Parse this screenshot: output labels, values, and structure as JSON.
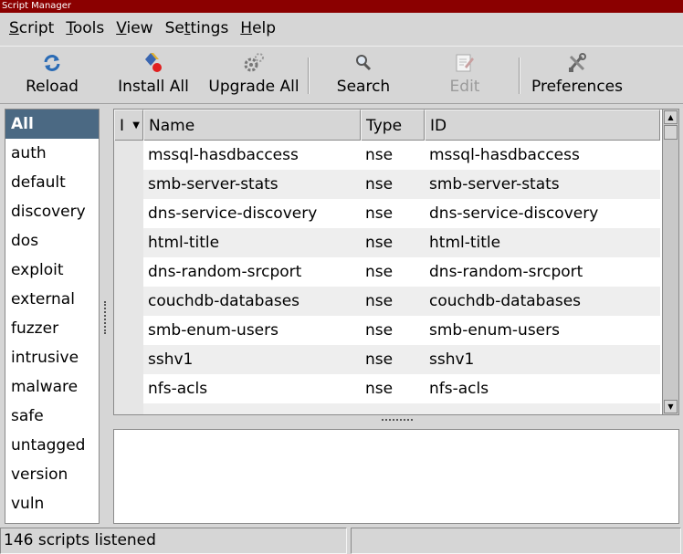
{
  "window": {
    "title": "Script Manager"
  },
  "menu": [
    {
      "pre": "",
      "u": "S",
      "post": "cript"
    },
    {
      "pre": "",
      "u": "T",
      "post": "ools"
    },
    {
      "pre": "",
      "u": "V",
      "post": "iew"
    },
    {
      "pre": "Se",
      "u": "t",
      "post": "tings"
    },
    {
      "pre": "",
      "u": "H",
      "post": "elp"
    }
  ],
  "toolbar": {
    "reload": "Reload",
    "install_all": "Install All",
    "upgrade_all": "Upgrade All",
    "search": "Search",
    "edit": "Edit",
    "preferences": "Preferences"
  },
  "categories": [
    "All",
    "auth",
    "default",
    "discovery",
    "dos",
    "exploit",
    "external",
    "fuzzer",
    "intrusive",
    "malware",
    "safe",
    "untagged",
    "version",
    "vuln"
  ],
  "selected_category": "All",
  "table": {
    "columns": [
      "I",
      "Name",
      "Type",
      "ID"
    ],
    "rows": [
      {
        "name": "mssql-hasdbaccess",
        "type": "nse",
        "id": "mssql-hasdbaccess"
      },
      {
        "name": "smb-server-stats",
        "type": "nse",
        "id": "smb-server-stats"
      },
      {
        "name": "dns-service-discovery",
        "type": "nse",
        "id": "dns-service-discovery"
      },
      {
        "name": "html-title",
        "type": "nse",
        "id": "html-title"
      },
      {
        "name": "dns-random-srcport",
        "type": "nse",
        "id": "dns-random-srcport"
      },
      {
        "name": "couchdb-databases",
        "type": "nse",
        "id": "couchdb-databases"
      },
      {
        "name": "smb-enum-users",
        "type": "nse",
        "id": "smb-enum-users"
      },
      {
        "name": "sshv1",
        "type": "nse",
        "id": "sshv1"
      },
      {
        "name": "nfs-acls",
        "type": "nse",
        "id": "nfs-acls"
      }
    ]
  },
  "status": {
    "text": "146 scripts listened"
  },
  "colors": {
    "titlebar": "#8b0000",
    "selection": "#4b6983"
  }
}
